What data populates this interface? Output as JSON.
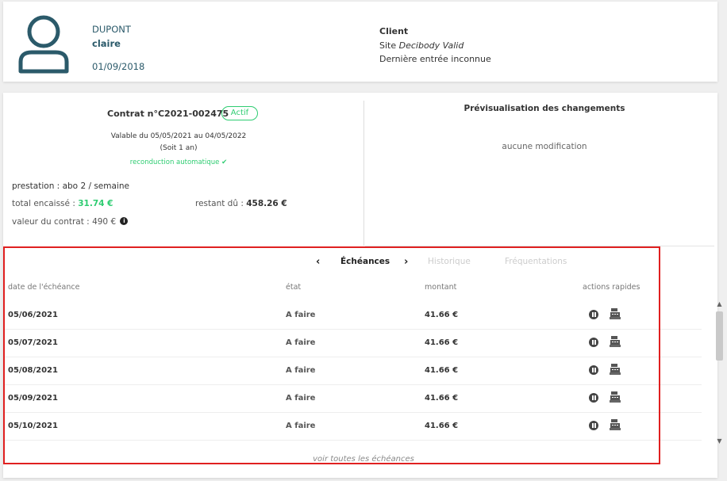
{
  "profile": {
    "last_name": "DUPONT",
    "first_name": "claire",
    "birth_date": "01/09/2018",
    "role": "Client",
    "site_label": "Site",
    "site_name": "Decibody Valid",
    "last_entry": "Dernière entrée inconnue"
  },
  "contract": {
    "title": "Contrat n°C2021-002475",
    "status": "Actif",
    "validity": "Valable du 05/05/2021 au 04/05/2022",
    "duration": "(Soit 1 an)",
    "renewal": "reconduction automatique",
    "prestation_label": "prestation :",
    "prestation_value": "abo 2 / semaine",
    "total_label": "total encaissé :",
    "total_value": "31.74 €",
    "remaining_label": "restant dû :",
    "remaining_value": "458.26 €",
    "value_label": "valeur du contrat :",
    "value_value": "490 €"
  },
  "preview": {
    "title": "Prévisualisation des changements",
    "empty": "aucune modification"
  },
  "tabs": {
    "prev_arrow": "‹",
    "next_arrow": "›",
    "items": [
      {
        "label": "Échéances"
      },
      {
        "label": "Historique"
      },
      {
        "label": "Fréquentations"
      }
    ]
  },
  "schedule": {
    "columns": [
      "date de l'échéance",
      "état",
      "montant",
      "actions rapides"
    ],
    "rows": [
      {
        "date": "05/06/2021",
        "state": "A faire",
        "amount": "41.66 €"
      },
      {
        "date": "05/07/2021",
        "state": "A faire",
        "amount": "41.66 €"
      },
      {
        "date": "05/08/2021",
        "state": "A faire",
        "amount": "41.66 €"
      },
      {
        "date": "05/09/2021",
        "state": "A faire",
        "amount": "41.66 €"
      },
      {
        "date": "05/10/2021",
        "state": "A faire",
        "amount": "41.66 €"
      }
    ],
    "see_all": "voir toutes les échéances",
    "actions": [
      "pause-icon",
      "cash-register-icon"
    ]
  },
  "colors": {
    "accent_green": "#2ecc71",
    "text_teal": "#2b5a6a",
    "highlight_red": "#e02020"
  }
}
